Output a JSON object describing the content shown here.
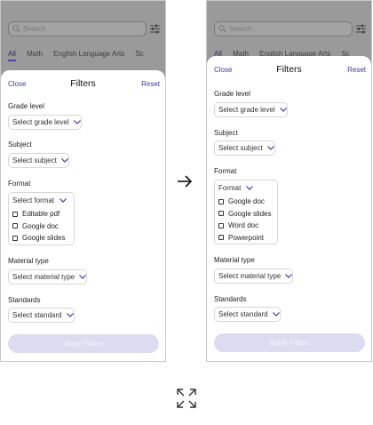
{
  "left": {
    "search_placeholder": "Search",
    "tabs": [
      "All",
      "Math",
      "English Language Arts",
      "Sc"
    ],
    "close": "Close",
    "title": "Filters",
    "reset": "Reset",
    "grade_label": "Grade level",
    "grade_value": "Select grade level",
    "subject_label": "Subject",
    "subject_value": "Select subject",
    "format_label": "Format",
    "format_value": "Select format",
    "format_options": [
      "Editable pdf",
      "Google doc",
      "Google slides"
    ],
    "material_label": "Material type",
    "material_value": "Select material type",
    "standards_label": "Standards",
    "standards_value": "Select standard",
    "apply": "Apply Filters"
  },
  "right": {
    "search_placeholder": "Search",
    "tabs": [
      "All",
      "Math",
      "English Language Arts",
      "Sc"
    ],
    "close": "Close",
    "title": "Filters",
    "reset": "Reset",
    "grade_label": "Grade level",
    "grade_value": "Select grade level",
    "subject_label": "Subject",
    "subject_value": "Select subject",
    "format_label": "Format",
    "format_value": "Format",
    "format_options": [
      "Google doc",
      "Google slides",
      "Word doc",
      "Powerpoint"
    ],
    "material_label": "Material type",
    "material_value": "Select material type",
    "standards_label": "Standards",
    "standards_value": "Select standard",
    "apply": "Apply Filters"
  },
  "colors": {
    "accent": "#3b3b9a",
    "overlay": "#9a9a9a",
    "apply_bg": "#dcdcf0"
  },
  "icons": [
    "search-icon",
    "tune-icon",
    "chevron-down-icon",
    "arrow-right-icon",
    "expand-icon"
  ]
}
